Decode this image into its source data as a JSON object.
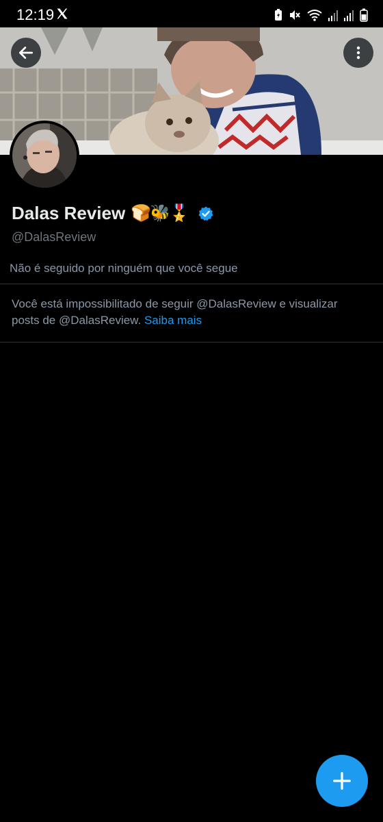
{
  "status_bar": {
    "time": "12:19",
    "icons": [
      "x-logo-icon",
      "battery-saver-icon",
      "mute-icon",
      "wifi-icon",
      "signal-icon",
      "signal-icon",
      "battery-icon"
    ]
  },
  "profile": {
    "display_name": "Dalas Review",
    "name_emojis": "🍞🐝🎖️",
    "verified": true,
    "handle": "@DalasReview",
    "followers_note": "Não é seguido por ninguém que você segue"
  },
  "blocked_notice": {
    "text": "Você está impossibilitado de seguir @DalasReview e visualizar posts de @DalasReview.",
    "link_text": "Saiba mais"
  },
  "actions": {
    "back_icon": "arrow-left-icon",
    "more_icon": "more-vertical-icon",
    "fab_icon": "plus-icon"
  },
  "colors": {
    "background": "#000000",
    "accent": "#1d9bf0",
    "secondary_text": "#71767b",
    "divider": "#2f3336"
  }
}
